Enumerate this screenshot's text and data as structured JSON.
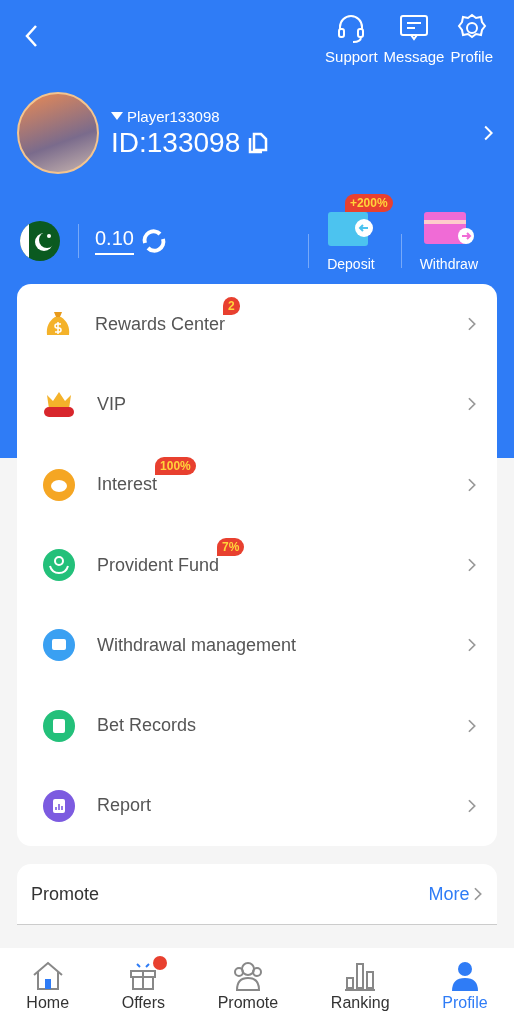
{
  "top_actions": [
    {
      "label": "Support"
    },
    {
      "label": "Message"
    },
    {
      "label": "Profile"
    }
  ],
  "user": {
    "name": "Player133098",
    "id": "ID:133098"
  },
  "balance": {
    "amount": "0.10"
  },
  "wallet_actions": [
    {
      "label": "Deposit",
      "badge": "+200%"
    },
    {
      "label": "Withdraw"
    }
  ],
  "menu": [
    {
      "label": "Rewards Center",
      "badge": "2"
    },
    {
      "label": "VIP"
    },
    {
      "label": "Interest",
      "badge": "100%"
    },
    {
      "label": "Provident Fund",
      "badge": "7%"
    },
    {
      "label": "Withdrawal management"
    },
    {
      "label": "Bet Records"
    },
    {
      "label": "Report"
    }
  ],
  "promote": {
    "title": "Promote",
    "more": "More"
  },
  "nav": [
    {
      "label": "Home",
      "selected": false,
      "dot": false
    },
    {
      "label": "Offers",
      "selected": false,
      "dot": true
    },
    {
      "label": "Promote",
      "selected": false,
      "dot": false
    },
    {
      "label": "Ranking",
      "selected": false,
      "dot": false
    },
    {
      "label": "Profile",
      "selected": true,
      "dot": false
    }
  ]
}
